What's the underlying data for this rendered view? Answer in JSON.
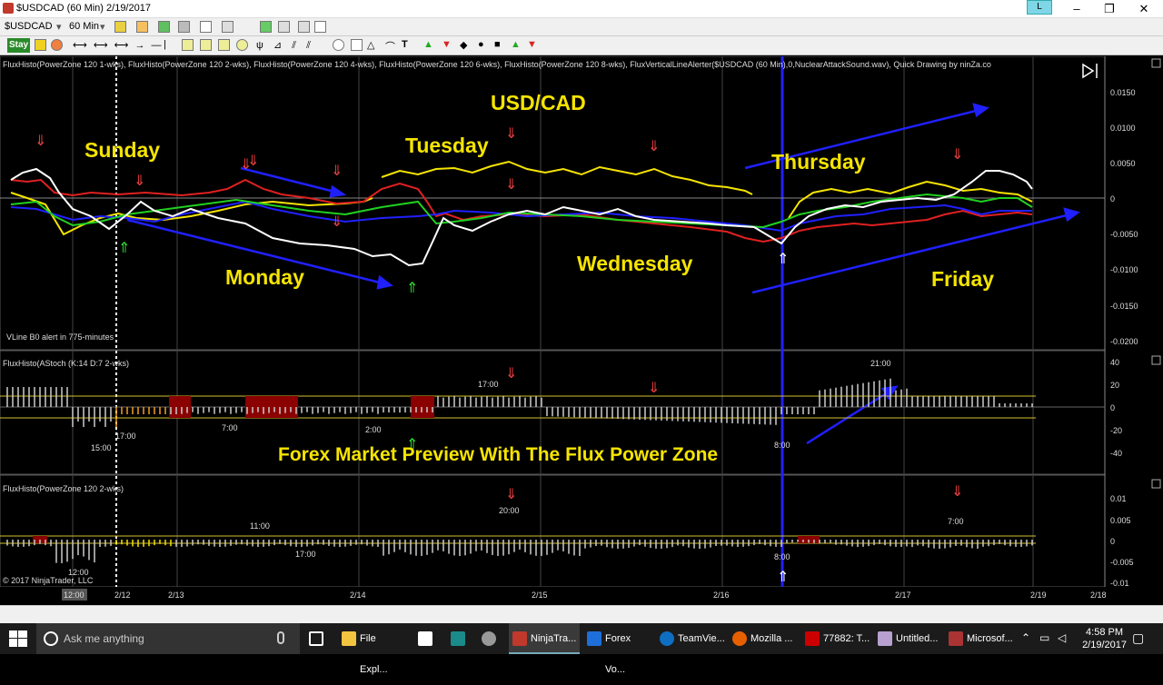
{
  "window": {
    "title": "$USDCAD (60 Min)  2/19/2017",
    "tag": "L"
  },
  "toolbar": {
    "instrument": "$USDCAD",
    "interval": "60 Min",
    "stay_label": "Stay"
  },
  "panels": {
    "price": {
      "header": "FluxHisto(PowerZone 120 1-wks), FluxHisto(PowerZone 120 2-wks), FluxHisto(PowerZone 120 4-wks), FluxHisto(PowerZone 120 6-wks), FluxHisto(PowerZone 120 8-wks), FluxVerticalLineAlerter($USDCAD (60 Min),0,NuclearAttackSound.wav), Quick Drawing by ninZa.co",
      "status": "VLine B0 alert in 775-minutes",
      "yticks": [
        "0.0150",
        "0.0100",
        "0.0050",
        "0",
        "-0.0050",
        "-0.0100",
        "-0.0150",
        "-0.0200"
      ]
    },
    "stoch": {
      "header": "FluxHisto(AStoch (K:14 D:7 2-wks)",
      "yticks": [
        "40",
        "20",
        "0",
        "-20",
        "-40"
      ],
      "time_labels": [
        "15:00",
        "17:00",
        "7:00",
        "2:00",
        "17:00",
        "21:00",
        "8:00"
      ]
    },
    "zone": {
      "header": "FluxHisto(PowerZone 120 2-wks)",
      "yticks": [
        "0.01",
        "0.005",
        "0",
        "-0.005",
        "-0.01"
      ],
      "time_labels": [
        "12:00",
        "11:00",
        "17:00",
        "20:00",
        "7:00",
        "8:00"
      ],
      "copyright": "© 2017 NinjaTrader, LLC"
    }
  },
  "annotations": {
    "pair": "USD/CAD",
    "days": [
      "Sunday",
      "Monday",
      "Tuesday",
      "Wednesday",
      "Thursday",
      "Friday"
    ],
    "caption": "Forex Market Preview With The Flux Power Zone"
  },
  "xaxis": {
    "labels": [
      "12:00",
      "2/12",
      "2/13",
      "2/14",
      "2/15",
      "2/16",
      "2/17",
      "2/19",
      "2/18"
    ]
  },
  "taskbar": {
    "search_placeholder": "Ask me anything",
    "items": [
      "File Expl...",
      "NinjaTra...",
      "Forex Vo...",
      "TeamVie...",
      "Mozilla ...",
      "77882: T...",
      "Untitled...",
      "Microsof..."
    ],
    "time": "4:58 PM",
    "date": "2/19/2017"
  },
  "colors": {
    "yellow": "#f5e400",
    "red": "#e02020",
    "blue": "#2020ff",
    "green": "#20d020",
    "white": "#ffffff",
    "maroon": "#8b0000"
  }
}
